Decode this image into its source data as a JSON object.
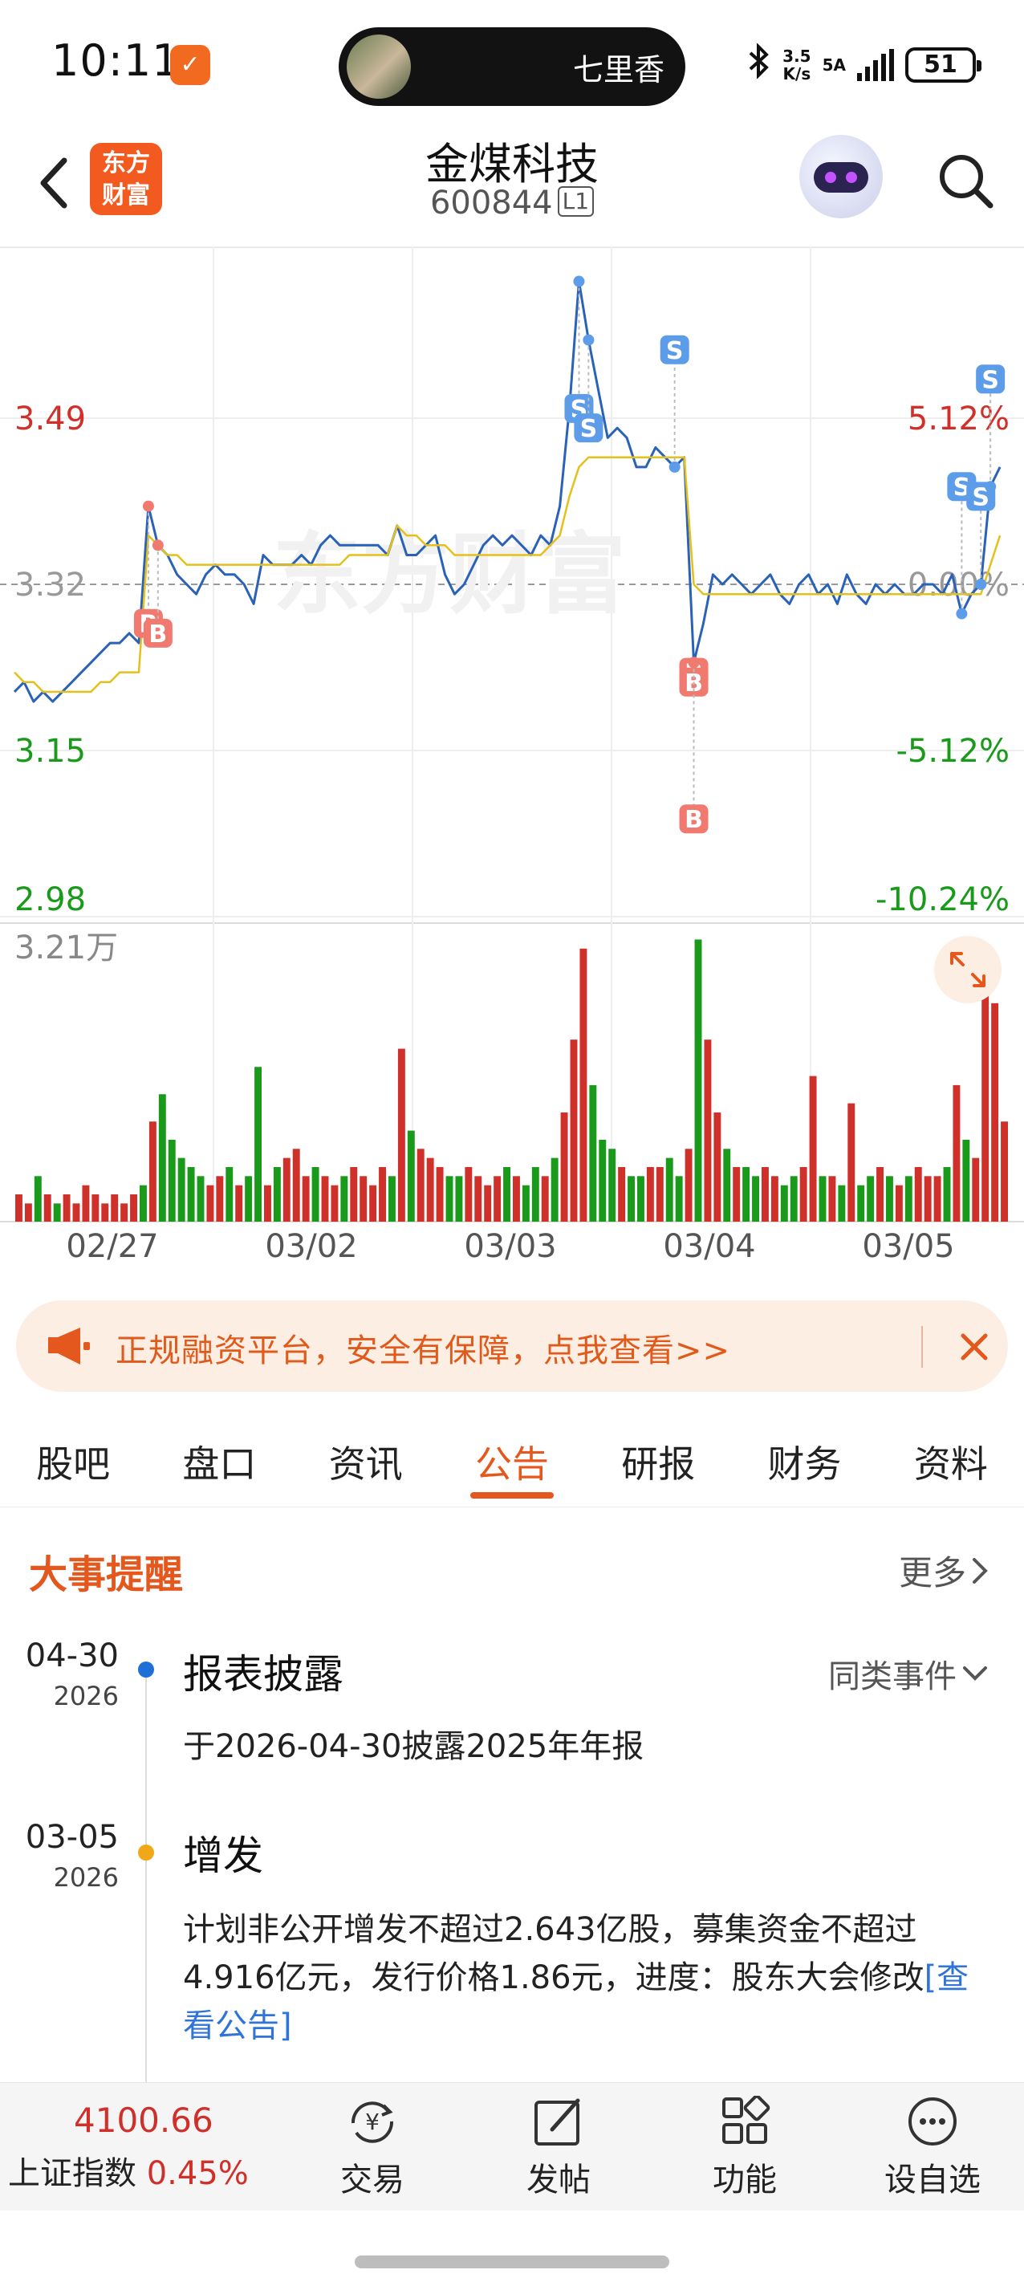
{
  "status_bar": {
    "time": "10:11",
    "island_text": "七里香",
    "net_speed_value": "3.5",
    "net_speed_unit": "K/s",
    "network": "5A",
    "battery": "51"
  },
  "header": {
    "logo_line1": "东方",
    "logo_line2": "财富",
    "stock_name": "金煤科技",
    "stock_code": "600844",
    "level_badge": "L1"
  },
  "chart_data": [
    {
      "type": "line",
      "x": [
        "02/27",
        "03/02",
        "03/03",
        "03/04",
        "03/05"
      ],
      "price_ticks": [
        "3.49",
        "3.32",
        "3.15",
        "2.98"
      ],
      "pct_ticks": [
        "5.12%",
        "0.00%",
        "-5.12%",
        "-10.24%"
      ],
      "ylim": [
        2.98,
        3.66
      ],
      "reference_price": 3.32,
      "series": [
        {
          "values": [
            3.21,
            3.22,
            3.2,
            3.21,
            3.2,
            3.21,
            3.22,
            3.23,
            3.24,
            3.25,
            3.26,
            3.26,
            3.27,
            3.26,
            3.4,
            3.36,
            3.35,
            3.33,
            3.32,
            3.31,
            3.33,
            3.34,
            3.33,
            3.33,
            3.32,
            3.3,
            3.35,
            3.34,
            3.34,
            3.34,
            3.35,
            3.34,
            3.36,
            3.37,
            3.36,
            3.36,
            3.36,
            3.36,
            3.36,
            3.35,
            3.38,
            3.35,
            3.35,
            3.36,
            3.37,
            3.33,
            3.31,
            3.32,
            3.34,
            3.36,
            3.37,
            3.36,
            3.37,
            3.36,
            3.35,
            3.37,
            3.36,
            3.4,
            3.5,
            3.63,
            3.57,
            3.52,
            3.47,
            3.48,
            3.47,
            3.44,
            3.44,
            3.46,
            3.45,
            3.44,
            3.45,
            3.24,
            3.28,
            3.33,
            3.32,
            3.33,
            3.32,
            3.31,
            3.32,
            3.33,
            3.31,
            3.3,
            3.32,
            3.33,
            3.31,
            3.32,
            3.3,
            3.33,
            3.31,
            3.3,
            3.32,
            3.31,
            3.32,
            3.31,
            3.31,
            3.32,
            3.32,
            3.31,
            3.33,
            3.29,
            3.31,
            3.32,
            3.42,
            3.44
          ]
        },
        {
          "values": [
            3.23,
            3.22,
            3.22,
            3.21,
            3.21,
            3.21,
            3.21,
            3.21,
            3.21,
            3.22,
            3.22,
            3.23,
            3.23,
            3.23,
            3.37,
            3.36,
            3.35,
            3.35,
            3.34,
            3.34,
            3.34,
            3.34,
            3.34,
            3.34,
            3.34,
            3.34,
            3.34,
            3.34,
            3.34,
            3.34,
            3.34,
            3.34,
            3.34,
            3.34,
            3.34,
            3.35,
            3.35,
            3.35,
            3.35,
            3.35,
            3.38,
            3.37,
            3.37,
            3.36,
            3.36,
            3.36,
            3.35,
            3.35,
            3.35,
            3.35,
            3.35,
            3.35,
            3.35,
            3.35,
            3.35,
            3.35,
            3.36,
            3.37,
            3.41,
            3.44,
            3.45,
            3.45,
            3.45,
            3.45,
            3.45,
            3.45,
            3.45,
            3.45,
            3.45,
            3.45,
            3.45,
            3.32,
            3.31,
            3.31,
            3.31,
            3.31,
            3.31,
            3.31,
            3.31,
            3.31,
            3.31,
            3.31,
            3.31,
            3.31,
            3.31,
            3.31,
            3.31,
            3.31,
            3.31,
            3.31,
            3.31,
            3.31,
            3.31,
            3.31,
            3.31,
            3.31,
            3.31,
            3.31,
            3.31,
            3.31,
            3.31,
            3.31,
            3.34,
            3.37
          ]
        }
      ],
      "trade_markers": [
        {
          "label": "B",
          "t": 14,
          "price": 3.28
        },
        {
          "label": "B",
          "t": 15,
          "price": 3.27
        },
        {
          "label": "S",
          "t": 59,
          "price": 3.5
        },
        {
          "label": "S",
          "t": 60,
          "price": 3.48
        },
        {
          "label": "S",
          "t": 69,
          "price": 3.56
        },
        {
          "label": "B",
          "t": 71,
          "price": 3.23
        },
        {
          "label": "B",
          "t": 71,
          "price": 3.22
        },
        {
          "label": "B",
          "t": 71,
          "price": 3.08
        },
        {
          "label": "S",
          "t": 99,
          "price": 3.42
        },
        {
          "label": "S",
          "t": 101,
          "price": 3.41
        },
        {
          "label": "S",
          "t": 102,
          "price": 3.53
        }
      ],
      "watermark": "东方财富"
    },
    {
      "type": "bar",
      "max_label": "3.21万",
      "ylim": [
        0,
        3.21
      ],
      "values": [
        0.3,
        0.2,
        0.5,
        0.3,
        0.2,
        0.3,
        0.2,
        0.4,
        0.3,
        0.2,
        0.3,
        0.2,
        0.3,
        0.4,
        1.1,
        1.4,
        0.9,
        0.7,
        0.6,
        0.5,
        0.4,
        0.5,
        0.6,
        0.4,
        0.5,
        1.7,
        0.4,
        0.6,
        0.7,
        0.8,
        0.5,
        0.6,
        0.5,
        0.4,
        0.5,
        0.6,
        0.5,
        0.4,
        0.6,
        0.5,
        1.9,
        1.0,
        0.8,
        0.7,
        0.6,
        0.5,
        0.5,
        0.6,
        0.5,
        0.4,
        0.5,
        0.6,
        0.5,
        0.4,
        0.6,
        0.5,
        0.7,
        1.2,
        2.0,
        3.0,
        1.5,
        0.9,
        0.8,
        0.6,
        0.5,
        0.5,
        0.6,
        0.6,
        0.7,
        0.5,
        0.8,
        3.1,
        2.0,
        1.2,
        0.8,
        0.6,
        0.6,
        0.5,
        0.6,
        0.5,
        0.4,
        0.5,
        0.6,
        1.6,
        0.5,
        0.5,
        0.4,
        1.3,
        0.4,
        0.5,
        0.6,
        0.5,
        0.4,
        0.5,
        0.6,
        0.5,
        0.5,
        0.6,
        1.5,
        0.9,
        0.7,
        2.6,
        2.4,
        1.1
      ]
    }
  ],
  "banner": {
    "text": "正规融资平台，安全有保障，点我查看>>"
  },
  "tabs": [
    "股吧",
    "盘口",
    "资讯",
    "公告",
    "研报",
    "财务",
    "资料"
  ],
  "active_tab": "公告",
  "events": {
    "title": "大事提醒",
    "more": "更多",
    "similar": "同类事件",
    "items": [
      {
        "date": "04-30",
        "year": "2026",
        "title": "报表披露",
        "body": "于2026-04-30披露2025年年报",
        "dot_color": "#1f6fd6"
      },
      {
        "date": "03-05",
        "year": "2026",
        "title": "增发",
        "body": "计划非公开增发不超过2.643亿股，募集资金不超过4.916亿元，发行价格1.86元，进度：股东大会修改",
        "link": "[查看公告]",
        "dot_color": "#f0a818"
      }
    ]
  },
  "bottom_bar": {
    "index_value": "4100.66",
    "index_name": "上证指数",
    "index_change": "0.45%",
    "nav": [
      "交易",
      "发帖",
      "功能",
      "设自选"
    ]
  },
  "colors": {
    "accent": "#e4571d",
    "up": "#d0302a",
    "down": "#1a9a1a",
    "price_line": "#2a62b8",
    "avg_line": "#e6c01a"
  }
}
